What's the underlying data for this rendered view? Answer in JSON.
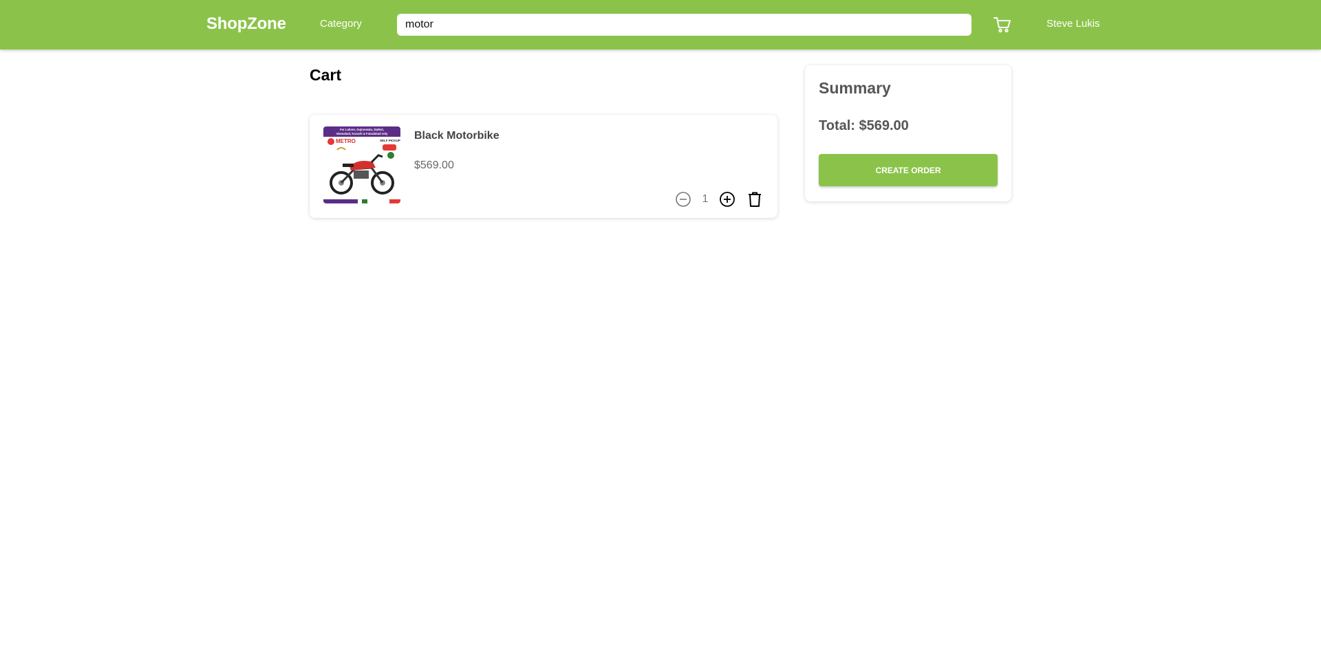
{
  "header": {
    "brand": "ShopZone",
    "category_label": "Category",
    "search": {
      "value": "motor",
      "placeholder": ""
    },
    "cart_icon": "cart-icon",
    "user_name": "Steve Lukis",
    "bg_color": "#8bc34a"
  },
  "cart": {
    "title": "Cart",
    "items": [
      {
        "name": "Black Motorbike",
        "price": "$569.00",
        "quantity": "1",
        "image": "motorbike-ad-image",
        "image_banner": "For Lahore, Gujranwala, Sialkot, Islamabad, Karachi & Faisalabad only",
        "image_tag": "SELF PICKUP",
        "image_brand": "METRO"
      }
    ],
    "icons": {
      "decrease": "minus-circle-icon",
      "increase": "plus-circle-icon",
      "delete": "trash-icon"
    }
  },
  "summary": {
    "title": "Summary",
    "total": "Total: $569.00",
    "button_label": "Create Order",
    "accent": "#8bc34a"
  }
}
